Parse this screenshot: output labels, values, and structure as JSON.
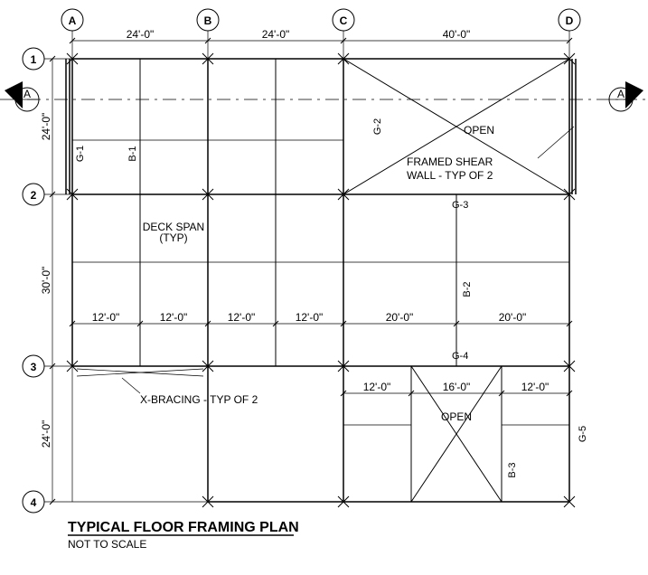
{
  "title": "TYPICAL FLOOR FRAMING PLAN",
  "subtitle": "NOT TO SCALE",
  "grid_cols": {
    "A": "A",
    "B": "B",
    "C": "C",
    "D": "D"
  },
  "grid_rows": {
    "1": "1",
    "2": "2",
    "3": "3",
    "4": "4"
  },
  "dims_x": {
    "AB": "24'-0\"",
    "BC": "24'-0\"",
    "CD": "40'-0\""
  },
  "dims_y": {
    "12": "24'-0\"",
    "23": "30'-0\"",
    "34": "24'-0\""
  },
  "beams": {
    "G1": "G-1",
    "B1": "B-1",
    "G2": "G-2",
    "G3": "G-3",
    "B2": "B-2",
    "G4": "G-4",
    "B3": "B-3",
    "G5": "G-5"
  },
  "notes": {
    "deck_span": "DECK SPAN\n(TYP)",
    "framed_shear": "FRAMED SHEAR\nWALL - TYP OF 2",
    "xbrace": "X-BRACING - TYP OF 2",
    "open": "OPEN"
  },
  "bay_dims": {
    "L1": "12'-0\"",
    "L2": "12'-0\"",
    "L3": "12'-0\"",
    "L4": "12'-0\"",
    "L5": "20'-0\"",
    "L6": "20'-0\"",
    "L7": "12'-0\"",
    "L8": "16'-0\"",
    "L9": "12'-0\""
  },
  "section_mark": "A"
}
